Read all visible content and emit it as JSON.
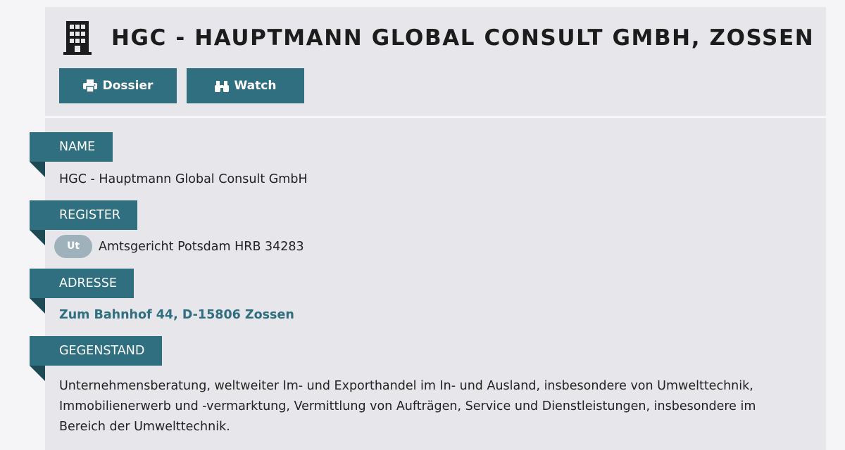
{
  "header": {
    "title": "HGC - HAUPTMANN GLOBAL CONSULT GMBH, ZOSSEN",
    "icon": "building-icon"
  },
  "actions": {
    "dossier_label": "Dossier",
    "dossier_icon": "print-icon",
    "watch_label": "Watch",
    "watch_icon": "binoculars-icon"
  },
  "sections": {
    "name": {
      "label": "NAME",
      "value": "HGC - Hauptmann Global Consult GmbH"
    },
    "register": {
      "label": "REGISTER",
      "badge": "Ut",
      "value": "Amtsgericht Potsdam HRB 34283"
    },
    "address": {
      "label": "ADRESSE",
      "value": "Zum Bahnhof 44, D-15806 Zossen"
    },
    "purpose": {
      "label": "GEGENSTAND",
      "value": "Unternehmensberatung, weltweiter Im- und Exporthandel im In- und Ausland, insbesondere von Umwelttechnik, Immobilienerwerb und -vermarktung, Vermittlung von Aufträgen, Service und Dienstleistungen, insbesondere im Bereich der Umwelttechnik."
    }
  },
  "colors": {
    "accent": "#2f6f80",
    "panel": "#e7e6ea",
    "badge": "#9fb2bc"
  }
}
